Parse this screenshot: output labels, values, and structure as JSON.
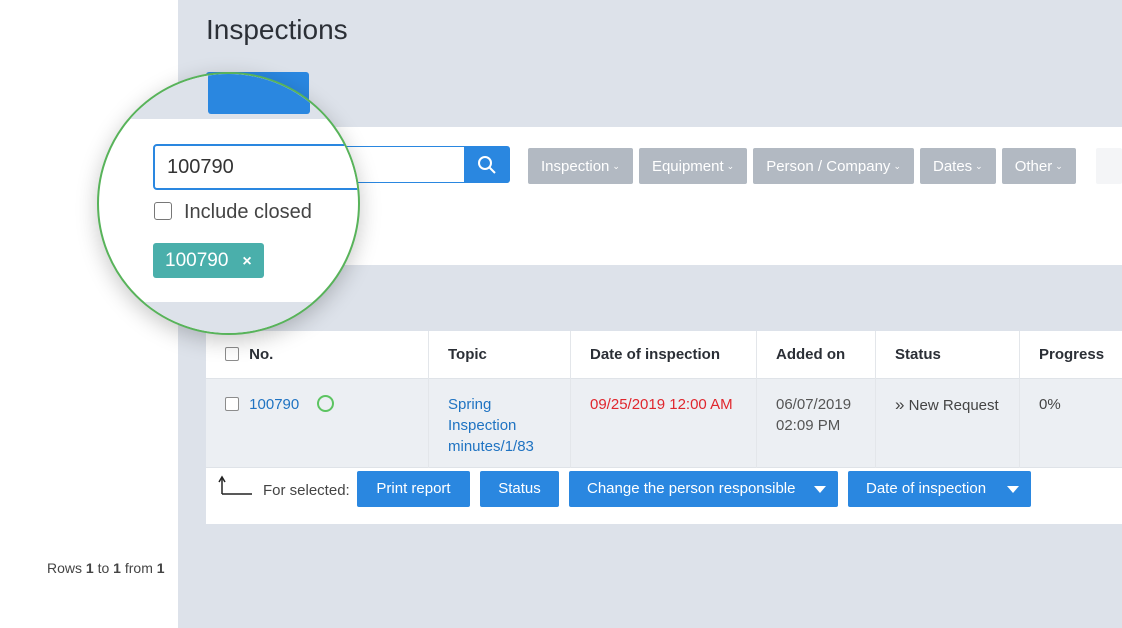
{
  "page": {
    "title": "Inspections"
  },
  "search": {
    "value": "100790",
    "clear_glyph": "×",
    "include_closed_label": "Include closed",
    "tag_label": "100790",
    "tag_remove": "×"
  },
  "filters": [
    {
      "label": "Inspection"
    },
    {
      "label": "Equipment"
    },
    {
      "label": "Person / Company"
    },
    {
      "label": "Dates"
    },
    {
      "label": "Other"
    }
  ],
  "rows_info": {
    "prefix": "Rows",
    "from_word": "from",
    "start": "1",
    "end": "1",
    "total": "1",
    "to_word": "to"
  },
  "table": {
    "headers": {
      "no": "No.",
      "topic": "Topic",
      "date": "Date of inspection",
      "added": "Added on",
      "status": "Status",
      "progress": "Progress"
    },
    "rows": [
      {
        "no": "100790",
        "topic_line1": "Spring",
        "topic_line2": "Inspection",
        "topic_line3": "minutes/1/83",
        "date": "09/25/2019 12:00 AM",
        "added_line1": "06/07/2019",
        "added_line2": "02:09 PM",
        "status": "New Request",
        "status_glyph": "»",
        "progress": "0%"
      }
    ]
  },
  "actions": {
    "for_selected": "For selected:",
    "print_report": "Print report",
    "status": "Status",
    "change_person": "Change the person responsible",
    "date_of_inspection": "Date of inspection"
  },
  "colors": {
    "primary": "#2a87e0",
    "filter_btn": "#b2b9c2",
    "tag": "#4aafab",
    "lens_border": "#58b35a",
    "date_red": "#e0262d"
  }
}
